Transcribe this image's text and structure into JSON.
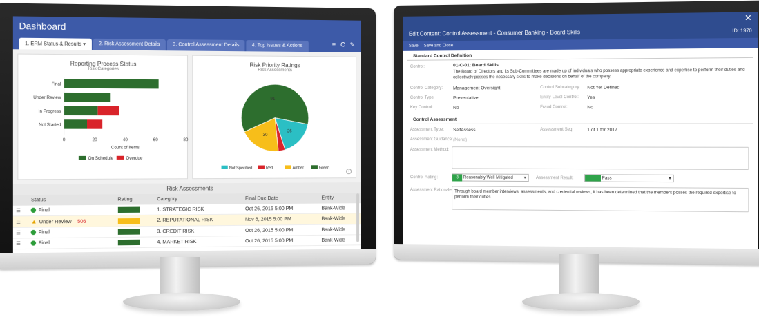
{
  "colors": {
    "header": "#3d5aa8",
    "green": "#2d6e2e",
    "red": "#d9242a",
    "amber": "#f7be1a",
    "cyan": "#2bbfc4",
    "pass": "#2fa34a"
  },
  "dashboard": {
    "title": "Dashboard",
    "tabs": [
      "1. ERM Status & Results",
      "2. Risk Assessment Details",
      "3. Control Assessment Details",
      "4. Top Issues & Actions"
    ],
    "tab_active_caret": "▾",
    "tools": {
      "list": "≡",
      "refresh": "C",
      "edit": "✎"
    },
    "reporting": {
      "title": "Reporting Process Status",
      "subtitle": "Risk Categories",
      "xlabel": "Count of Items",
      "legend": [
        "On Schedule",
        "Overdue"
      ]
    },
    "priority": {
      "title": "Risk Priority Ratings",
      "subtitle": "Risk Assessments",
      "legend": [
        "Not Specified",
        "Red",
        "Amber",
        "Green"
      ]
    },
    "risk_assessments": {
      "title": "Risk Assessments",
      "columns": [
        "Status",
        "Rating",
        "Category",
        "Final Due Date",
        "Entity"
      ],
      "rows": [
        {
          "status": "Final",
          "status_type": "final",
          "overdue": "",
          "rating": "green",
          "category": "1. STRATEGIC RISK",
          "due": "Oct 26, 2015 5:00 PM",
          "entity": "Bank-Wide"
        },
        {
          "status": "Under Review",
          "status_type": "warning",
          "overdue": "506",
          "rating": "amber",
          "category": "2. REPUTATIONAL RISK",
          "due": "Nov 6, 2015 5:00 PM",
          "entity": "Bank-Wide"
        },
        {
          "status": "Final",
          "status_type": "final",
          "overdue": "",
          "rating": "green",
          "category": "3. CREDIT RISK",
          "due": "Oct 26, 2015 5:00 PM",
          "entity": "Bank-Wide"
        },
        {
          "status": "Final",
          "status_type": "final",
          "overdue": "",
          "rating": "green",
          "category": "4. MARKET RISK",
          "due": "Oct 26, 2015 5:00 PM",
          "entity": "Bank-Wide"
        }
      ]
    }
  },
  "chart_data": [
    {
      "type": "bar",
      "title": "Reporting Process Status",
      "subtitle": "Risk Categories",
      "xlabel": "Count of Items",
      "ylabel": "",
      "orientation": "horizontal",
      "stacked": true,
      "categories": [
        "Final",
        "Under Review",
        "In Progress",
        "Not Started"
      ],
      "series": [
        {
          "name": "On Schedule",
          "color": "#2d6e2e",
          "values": [
            62,
            30,
            22,
            15
          ]
        },
        {
          "name": "Overdue",
          "color": "#d9242a",
          "values": [
            0,
            0,
            14,
            10
          ]
        }
      ],
      "data_labels": [
        [
          "",
          "",
          "",
          ""
        ],
        [
          "",
          "",
          "",
          ""
        ]
      ],
      "xlim": [
        0,
        80
      ],
      "xticks": [
        0,
        20,
        40,
        60,
        80
      ],
      "legend_position": "bottom"
    },
    {
      "type": "pie",
      "title": "Risk Priority Ratings",
      "subtitle": "Risk Assessments",
      "slices": [
        {
          "label": "Green",
          "value": 91,
          "color": "#2d6e2e",
          "text": "91"
        },
        {
          "label": "Not Specified",
          "value": 26,
          "color": "#2bbfc4",
          "text": "26"
        },
        {
          "label": "Red",
          "value": 5,
          "color": "#d9242a",
          "text": ""
        },
        {
          "label": "Amber",
          "value": 30,
          "color": "#f7be1a",
          "text": "30"
        }
      ],
      "legend_position": "bottom"
    }
  ],
  "edit": {
    "title": "Edit Content: Control Assessment - Consumer Banking - Board Skills",
    "id": "ID: 1970",
    "close": "✕",
    "toolbar": {
      "save": "Save",
      "save_close": "Save and Close"
    },
    "std_section": "Standard Control Definition",
    "control_label": "Control:",
    "control_name": "01-C-01: Board Skills",
    "control_desc": "The Board of Directors and its Sub-Committees are made up of individuals who possess appropriate experience and expertise to perform their duties and collectively posses the necessary skills to make decisions on behalf of the company.",
    "category_label": "Control Category:",
    "category_value": "Management Oversight",
    "subcategory_label": "Control Subcategory:",
    "subcategory_value": "Not Yet Defined",
    "type_label": "Control Type:",
    "type_value": "Preventative",
    "entity_label": "Entity-Level Control:",
    "entity_value": "Yes",
    "key_label": "Key Control:",
    "key_value": "No",
    "fraud_label": "Fraud Control:",
    "fraud_value": "No",
    "ca_section": "Control Assessment",
    "atype_label": "Assessment Type:",
    "atype_value": "SelfAssess",
    "aseq_label": "Assessment Seq:",
    "aseq_value": "1 of 1 for 2017",
    "guidance_label": "Assessment Guidance:",
    "guidance_value": "(None)",
    "method_label": "Assessment Method:",
    "rating_label": "Control Rating:",
    "rating_num": "3",
    "rating_value": "Reasonably Well Mitigated",
    "result_label": "Assessment Result:",
    "result_value": "Pass",
    "rationale_label": "Assessment Rationale:",
    "rationale_value": "Through board member interviews, assessments, and credential reviews, it has been determined that the members posses the required expertise to perform their duties."
  }
}
